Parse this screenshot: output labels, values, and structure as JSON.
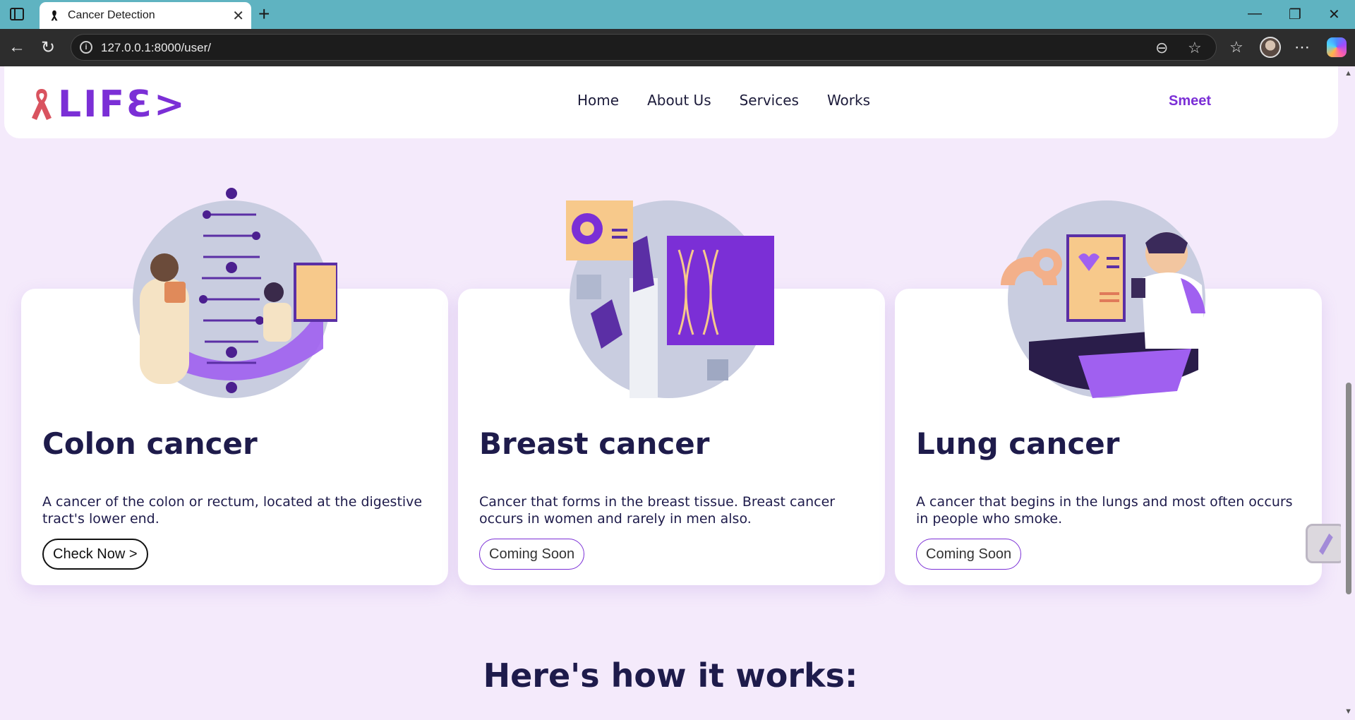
{
  "browser": {
    "tab_title": "Cancer Detection",
    "url": "127.0.0.1:8000/user/",
    "new_tab_symbol": "+",
    "close_symbol": "✕"
  },
  "site": {
    "logo_text": "LIFƐ>",
    "nav": [
      "Home",
      "About Us",
      "Services",
      "Works"
    ],
    "user_name": "Smeet"
  },
  "cards": [
    {
      "title": "Colon cancer",
      "description": "A cancer of the colon or rectum, located at the digestive tract's lower end.",
      "button": "Check Now >",
      "illustration": "dna-researchers-illustration"
    },
    {
      "title": "Breast cancer",
      "description": "Cancer that forms in the breast tissue. Breast cancer occurs in women and rarely in men also.",
      "button": "Coming Soon",
      "illustration": "lab-hands-dna-illustration"
    },
    {
      "title": "Lung cancer",
      "description": "A cancer that begins in the lungs and most often occurs in people who smoke.",
      "button": "Coming Soon",
      "illustration": "man-at-monitor-illustration"
    }
  ],
  "section_heading": "Here's how it works:",
  "colors": {
    "brand_purple": "#7b2fd6",
    "heading_navy": "#1e1b4b",
    "page_bg": "#f4eafb",
    "ribbon_red": "#d9535f"
  }
}
